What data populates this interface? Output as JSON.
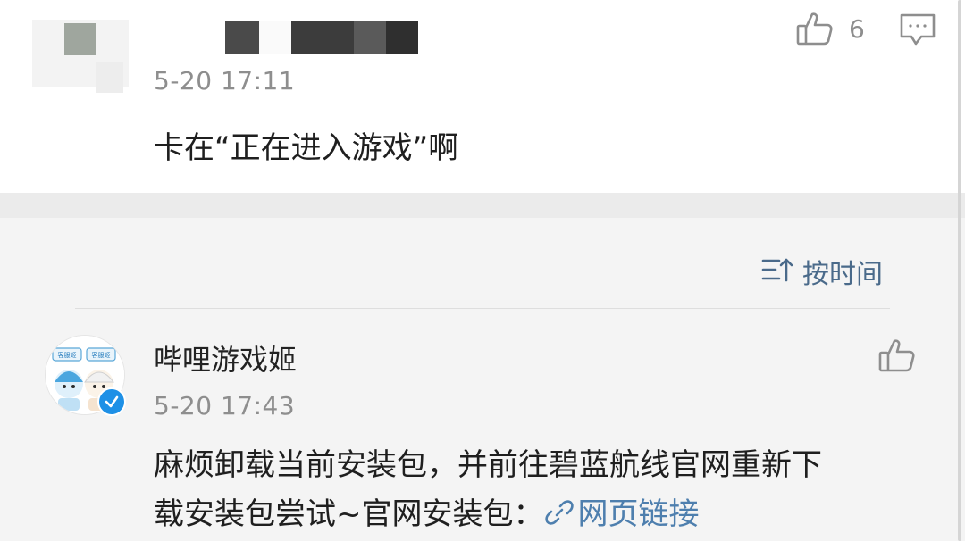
{
  "top_comment": {
    "likes": "6",
    "time": "5-20 17:11",
    "text": "卡在“正在进入游戏”啊"
  },
  "sort": {
    "label": "按时间"
  },
  "reply": {
    "username": "哔哩游戏姬",
    "time": "5-20 17:43",
    "text_line1": "麻烦卸载当前安装包，并前往碧蓝航线官网重新下",
    "text_line2": "载安装包尝试~官网安装包：",
    "link_label": "网页链接",
    "avatar_tag": "客服姬"
  },
  "icons": {
    "like": "thumbs-up-icon",
    "reply": "comment-reply-icon",
    "sort": "sort-icon",
    "link": "link-icon",
    "verified": "verified-check-icon"
  },
  "colors": {
    "accent_link": "#4e7fae",
    "verified": "#1e90e6",
    "muted_text": "#8e8e8e"
  }
}
